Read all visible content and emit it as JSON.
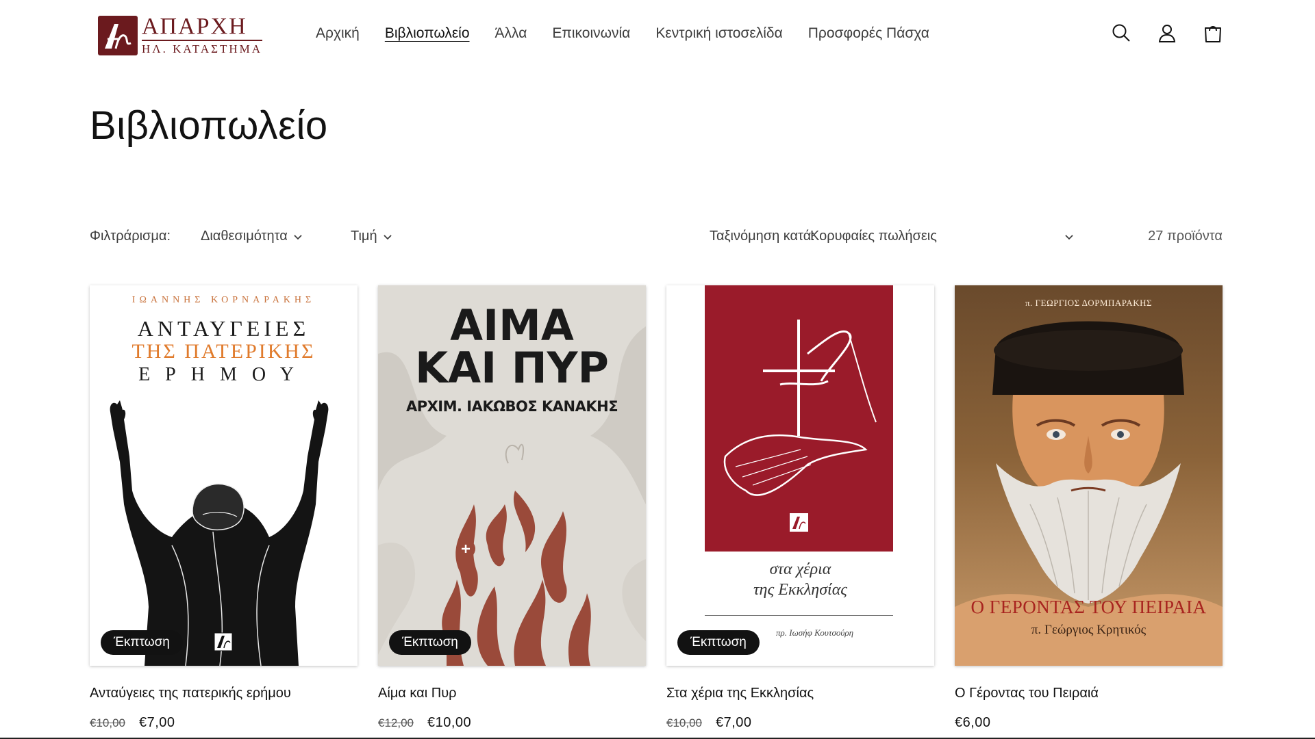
{
  "brand": {
    "title": "ΑΠΑΡΧΗ",
    "subtitle": "ΗΛ. ΚΑΤΑΣΤΗΜΑ",
    "color": "#6b1a1e"
  },
  "nav": {
    "items": [
      {
        "label": "Αρχική"
      },
      {
        "label": "Βιβλιοπωλείο",
        "active": true
      },
      {
        "label": "Άλλα"
      },
      {
        "label": "Επικοινωνία"
      },
      {
        "label": "Κεντρική ιστοσελίδα"
      },
      {
        "label": "Προσφορές Πάσχα"
      }
    ]
  },
  "header_icons": [
    "search-icon",
    "account-icon",
    "cart-icon"
  ],
  "page": {
    "title": "Βιβλιοπωλείο"
  },
  "filters": {
    "label": "Φιλτράρισμα:",
    "availability": "Διαθεσιμότητα",
    "price": "Τιμή",
    "sort_label": "Ταξινόμηση κατά:",
    "sort_value": "Κορυφαίες πωλήσεις",
    "count": "27 προϊόντα"
  },
  "products": [
    {
      "title": "Ανταύγειες της πατερικής ερήμου",
      "old_price": "€10,00",
      "price": "€7,00",
      "badge": "Έκπτωση",
      "cover": {
        "author": "ΙΩΑΝΝΗΣ ΚΟΡΝΑΡΑΚΗΣ",
        "line1": "ΑΝΤΑΥΓΕΙΕΣ",
        "line2": "ΤΗΣ ΠΑΤΕΡΙΚΗΣ",
        "line3": "ΕΡΗΜΟΥ"
      }
    },
    {
      "title": "Αίμα και Πυρ",
      "old_price": "€12,00",
      "price": "€10,00",
      "badge": "Έκπτωση",
      "cover": {
        "line1": "ΑΙΜΑ",
        "line2": "ΚΑΙ ΠΥΡ",
        "author": "ΑΡΧΙΜ. ΙΑΚΩΒΟΣ ΚΑΝΑΚΗΣ"
      }
    },
    {
      "title": "Στα χέρια της Εκκλησίας",
      "old_price": "€10,00",
      "price": "€7,00",
      "badge": "Έκπτωση",
      "cover": {
        "line1": "στα χέρια",
        "line2": "της Εκκλησίας",
        "author": "πρ. Ιωσήφ Κουτσούρη"
      }
    },
    {
      "title": "Ο Γέροντας του Πειραιά",
      "price": "€6,00",
      "cover": {
        "author": "π. ΓΕΩΡΓΙΟΣ ΔΟΡΜΠΑΡΑΚΗΣ",
        "line1": "Ο ΓΕΡΟΝΤΑΣ ΤΟΥ ΠΕΙΡΑΙΑ",
        "line2": "π. Γεώργιος Κρητικός"
      }
    }
  ]
}
